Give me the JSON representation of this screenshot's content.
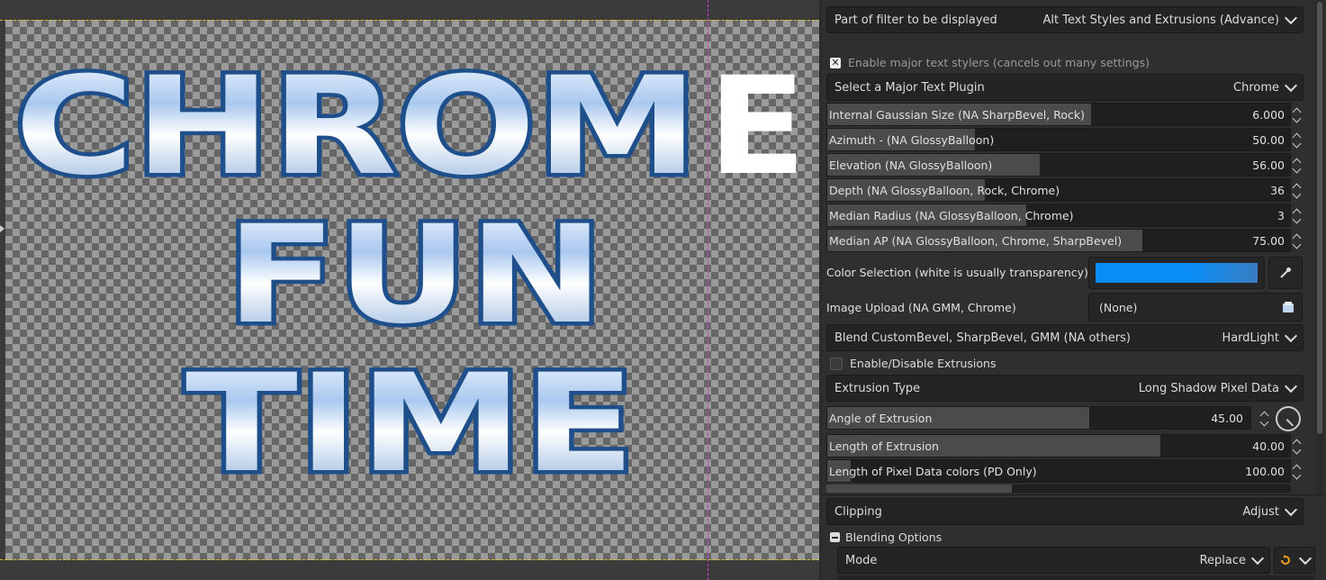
{
  "canvas": {
    "text_lines": [
      "CHROM",
      "E",
      "FUN",
      "TIME"
    ]
  },
  "panel": {
    "filter_display": {
      "label": "Part of filter to be displayed",
      "value": "Alt Text Styles and Extrusions (Advance)"
    },
    "enable_stylers": {
      "label": "Enable major text stylers (cancels out many settings)",
      "checked": true
    },
    "major_plugin": {
      "label": "Select a Major Text Plugin",
      "value": "Chrome"
    },
    "sliders": [
      {
        "label": "Internal Gaussian Size (NA SharpBevel, Rock)",
        "value": "6.000",
        "fraction": 0.57
      },
      {
        "label": "Azimuth - (NA GlossyBalloon)",
        "value": "50.00",
        "fraction": 0.32
      },
      {
        "label": "Elevation (NA GlossyBalloon)",
        "value": "56.00",
        "fraction": 0.46
      },
      {
        "label": "Depth (NA GlossyBalloon, Rock, Chrome)",
        "value": "36",
        "fraction": 0.34
      },
      {
        "label": "Median Radius (NA GlossyBalloon, Chrome)",
        "value": "3",
        "fraction": 0.43
      },
      {
        "label": "Median AP (NA GlossyBalloon, Chrome, SharpBevel)",
        "value": "75.00",
        "fraction": 0.68
      }
    ],
    "color_selection": {
      "label": "Color Selection (white is usually transparency)",
      "color": "#0a8cf5"
    },
    "image_upload": {
      "label": "Image Upload (NA GMM, Chrome)",
      "value": "(None)"
    },
    "blend": {
      "label": "Blend CustomBevel, SharpBevel, GMM (NA others)",
      "value": "HardLight"
    },
    "enable_extrusions": {
      "label": "Enable/Disable Extrusions",
      "checked": false
    },
    "extrusion_type": {
      "label": "Extrusion Type",
      "value": "Long Shadow Pixel Data"
    },
    "angle": {
      "label": "Angle of Extrusion",
      "value": "45.00",
      "fraction": 0.62
    },
    "length": {
      "label": "Length of Extrusion",
      "value": "40.00",
      "fraction": 0.72
    },
    "pd_length": {
      "label": "Length of Pixel Data colors (PD Only)",
      "value": "100.00",
      "fraction": 0.05
    },
    "clipping": {
      "label": "Clipping",
      "value": "Adjust"
    },
    "blending_options": {
      "label": "Blending Options"
    },
    "mode": {
      "label": "Mode",
      "value": "Replace"
    }
  },
  "colors": {
    "chrome_blue": "#1e4f8a",
    "accent": "#0a8cf5"
  }
}
